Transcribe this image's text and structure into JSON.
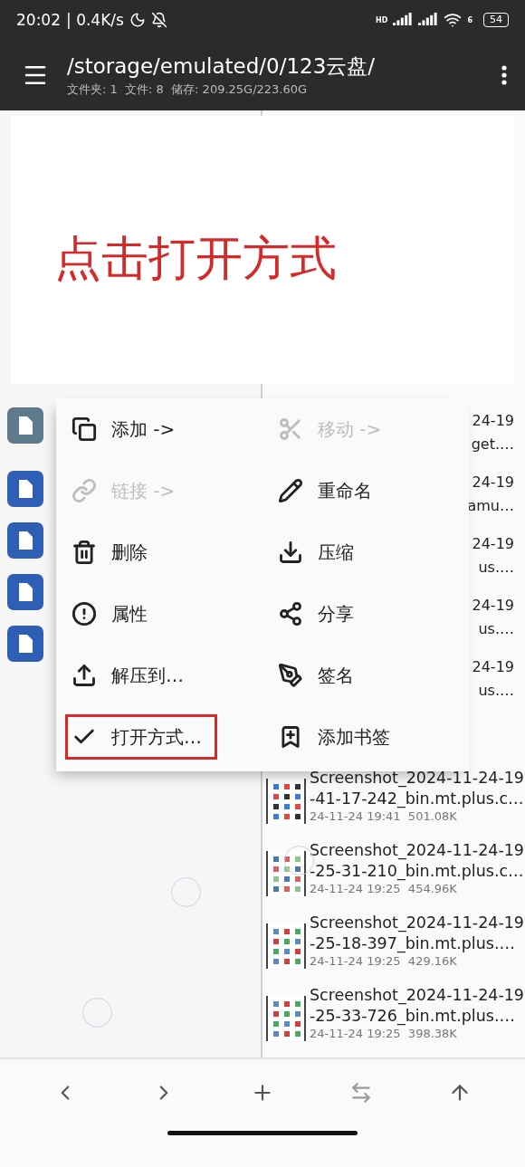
{
  "status_bar": {
    "time": "20:02",
    "speed": "| 0.4K/s",
    "signal_label": "HD",
    "wifi_label": "6",
    "battery": "54"
  },
  "toolbar": {
    "title": "/storage/emulated/0/123云盘/",
    "subtitle": "文件夹: 1  文件: 8  储存: 209.25G/223.60G"
  },
  "left_pane": {
    "icons": [
      {
        "color": "#5f7a8c"
      },
      {
        "color": "#2f5fb5"
      },
      {
        "color": "#2f5fb5"
      },
      {
        "color": "#2f5fb5"
      },
      {
        "color": "#2f5fb5"
      }
    ]
  },
  "right_pane": {
    "partial_rows": [
      {
        "line_1": "24-19",
        "line_2": "get.…"
      },
      {
        "line_1": "24-19",
        "line_2": "amu…"
      },
      {
        "line_1": "24-19",
        "line_2": "us.…"
      },
      {
        "line_1": "24-19",
        "line_2": "us.…"
      },
      {
        "line_1": "24-19",
        "line_2": "us.…"
      }
    ],
    "files": [
      {
        "name": "Screenshot_2024-11-24-19\n-41-17-242_bin.mt.plus.c…",
        "meta": "24-11-24 19:41  501.08K"
      },
      {
        "name": "Screenshot_2024-11-24-19\n-25-31-210_bin.mt.plus.c…",
        "meta": "24-11-24 19:25  454.96K"
      },
      {
        "name": "Screenshot_2024-11-24-19\n-25-18-397_bin.mt.plus.…",
        "meta": "24-11-24 19:25  429.16K"
      },
      {
        "name": "Screenshot_2024-11-24-19\n-25-33-726_bin.mt.plus.…",
        "meta": "24-11-24 19:25  398.38K"
      }
    ]
  },
  "annotation": {
    "text": "点击打开方式"
  },
  "menu": {
    "items": [
      {
        "label": "添加 ->",
        "disabled": false,
        "highlighted": false
      },
      {
        "label": "移动 ->",
        "disabled": true,
        "highlighted": false
      },
      {
        "label": "链接 ->",
        "disabled": true,
        "highlighted": false
      },
      {
        "label": "重命名",
        "disabled": false,
        "highlighted": false
      },
      {
        "label": "删除",
        "disabled": false,
        "highlighted": false
      },
      {
        "label": "压缩",
        "disabled": false,
        "highlighted": false
      },
      {
        "label": "属性",
        "disabled": false,
        "highlighted": false
      },
      {
        "label": "分享",
        "disabled": false,
        "highlighted": false
      },
      {
        "label": "解压到…",
        "disabled": false,
        "highlighted": false
      },
      {
        "label": "签名",
        "disabled": false,
        "highlighted": false
      },
      {
        "label": "打开方式…",
        "disabled": false,
        "highlighted": true
      },
      {
        "label": "添加书签",
        "disabled": false,
        "highlighted": false
      }
    ]
  },
  "bottom_nav": [
    {
      "disabled": false
    },
    {
      "disabled": false
    },
    {
      "disabled": false
    },
    {
      "disabled": true
    },
    {
      "disabled": false
    }
  ]
}
